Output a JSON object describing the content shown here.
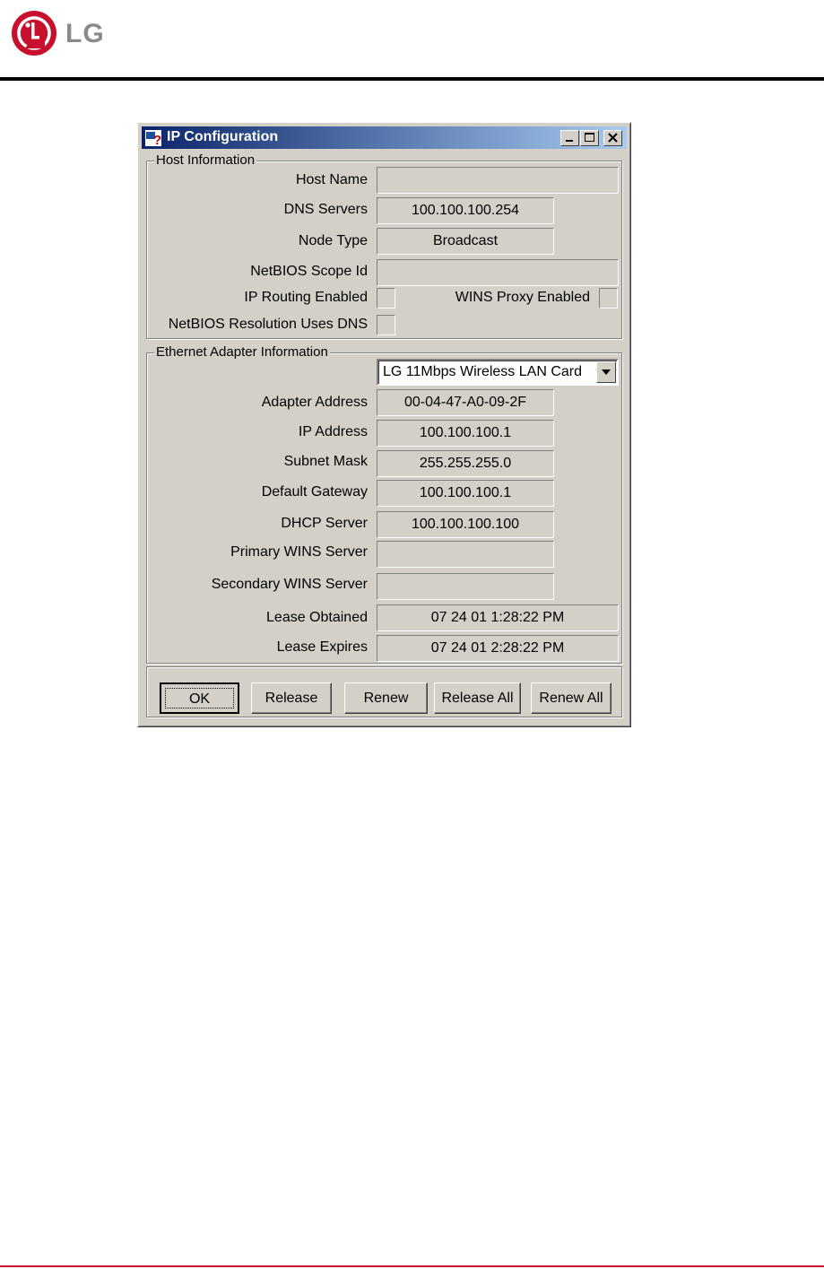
{
  "page": {
    "brand": "LG",
    "colors": {
      "header_rule": "#000000",
      "footer_rule": "#c8102e",
      "logo_red": "#c8102e",
      "logo_gray": "#8a8a8a"
    }
  },
  "window": {
    "title": "IP Configuration",
    "icons": [
      "ip-config-app-icon",
      "minimize-icon",
      "maximize-icon",
      "close-icon"
    ],
    "host": {
      "legend": "Host Information",
      "host_name_label": "Host Name",
      "host_name_value": "",
      "dns_label": "DNS Servers",
      "dns_value": "100.100.100.254",
      "node_type_label": "Node Type",
      "node_type_value": "Broadcast",
      "scope_label": "NetBIOS Scope Id",
      "scope_value": "",
      "ip_routing_label": "IP Routing Enabled",
      "ip_routing_checked": false,
      "wins_proxy_label": "WINS Proxy Enabled",
      "wins_proxy_checked": false,
      "netbios_dns_label": "NetBIOS Resolution Uses DNS",
      "netbios_dns_checked": false
    },
    "adapter": {
      "legend": "Ethernet  Adapter Information",
      "selected_adapter": "LG 11Mbps Wireless LAN Card",
      "adapter_address_label": "Adapter Address",
      "adapter_address_value": "00-04-47-A0-09-2F",
      "ip_label": "IP Address",
      "ip_value": "100.100.100.1",
      "subnet_label": "Subnet Mask",
      "subnet_value": "255.255.255.0",
      "gateway_label": "Default Gateway",
      "gateway_value": "100.100.100.1",
      "dhcp_label": "DHCP Server",
      "dhcp_value": "100.100.100.100",
      "primary_wins_label": "Primary WINS Server",
      "primary_wins_value": "",
      "secondary_wins_label": "Secondary WINS Server",
      "secondary_wins_value": "",
      "lease_obtained_label": "Lease Obtained",
      "lease_obtained_value": "07 24 01 1:28:22 PM",
      "lease_expires_label": "Lease Expires",
      "lease_expires_value": "07 24 01 2:28:22 PM"
    },
    "buttons": {
      "ok": "OK",
      "release": "Release",
      "renew": "Renew",
      "release_all": "Release All",
      "renew_all": "Renew All"
    }
  }
}
